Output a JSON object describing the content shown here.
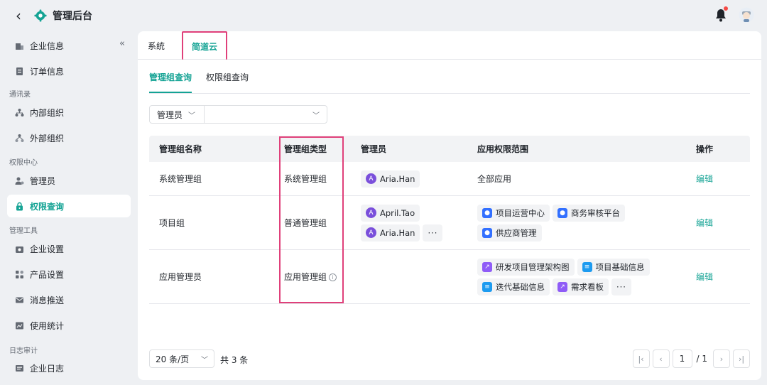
{
  "header": {
    "title": "管理后台",
    "back_icon": "chevron-left-icon",
    "app_icon": "gear-icon"
  },
  "sidebar": {
    "collapse_glyph": "«",
    "items": [
      {
        "label": "企业信息",
        "icon": "building-icon"
      },
      {
        "label": "订单信息",
        "icon": "order-icon"
      },
      {
        "label": "内部组织",
        "icon": "org-icon"
      },
      {
        "label": "外部组织",
        "icon": "external-org-icon"
      },
      {
        "label": "管理员",
        "icon": "admin-icon"
      },
      {
        "label": "权限查询",
        "icon": "lock-icon"
      },
      {
        "label": "企业设置",
        "icon": "settings-icon"
      },
      {
        "label": "产品设置",
        "icon": "grid-icon"
      },
      {
        "label": "消息推送",
        "icon": "mail-icon"
      },
      {
        "label": "使用统计",
        "icon": "chart-icon"
      },
      {
        "label": "企业日志",
        "icon": "log-icon"
      }
    ],
    "sections": [
      "通讯录",
      "权限中心",
      "管理工具",
      "日志审计"
    ],
    "active": "权限查询"
  },
  "tabs_top": [
    "系统",
    "简道云"
  ],
  "subtabs": [
    "管理组查询",
    "权限组查询"
  ],
  "filter": {
    "selected": "管理员",
    "value": ""
  },
  "table": {
    "headers": [
      "管理组名称",
      "管理组类型",
      "管理员",
      "应用权限范围",
      "操作"
    ],
    "rows": [
      {
        "name": "系统管理组",
        "type": "系统管理组",
        "admins": [
          "Aria.Han"
        ],
        "scope_text": "全部应用",
        "op": "编辑"
      },
      {
        "name": "项目组",
        "type": "普通管理组",
        "admins": [
          "April.Tao",
          "Aria.Han"
        ],
        "apps": [
          "项目运营中心",
          "商务审核平台",
          "供应商管理"
        ],
        "op": "编辑"
      },
      {
        "name": "应用管理员",
        "type": "应用管理组",
        "apps": [
          "研发项目管理架构图",
          "项目基础信息",
          "迭代基础信息",
          "需求看板"
        ],
        "op": "编辑"
      }
    ],
    "more": "···",
    "avatar_letter": "A",
    "info_glyph": "i"
  },
  "pagination": {
    "page_size": "20 条/页",
    "total": "共 3 条",
    "page": "1",
    "total_pages": "/ 1"
  },
  "colors": {
    "accent": "#14a394",
    "highlight": "#e0407a",
    "avatar": "#7a4fdb"
  }
}
